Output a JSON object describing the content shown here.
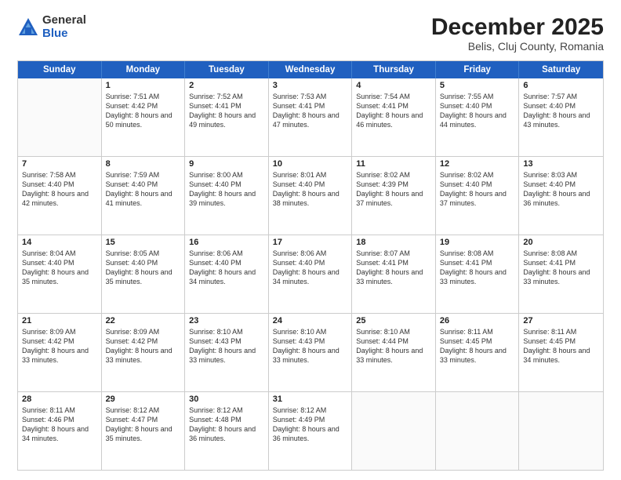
{
  "logo": {
    "general": "General",
    "blue": "Blue"
  },
  "title": "December 2025",
  "location": "Belis, Cluj County, Romania",
  "days": [
    "Sunday",
    "Monday",
    "Tuesday",
    "Wednesday",
    "Thursday",
    "Friday",
    "Saturday"
  ],
  "weeks": [
    [
      {
        "day": "",
        "empty": true
      },
      {
        "day": "1",
        "sunrise": "7:51 AM",
        "sunset": "4:42 PM",
        "daylight": "8 hours and 50 minutes."
      },
      {
        "day": "2",
        "sunrise": "7:52 AM",
        "sunset": "4:41 PM",
        "daylight": "8 hours and 49 minutes."
      },
      {
        "day": "3",
        "sunrise": "7:53 AM",
        "sunset": "4:41 PM",
        "daylight": "8 hours and 47 minutes."
      },
      {
        "day": "4",
        "sunrise": "7:54 AM",
        "sunset": "4:41 PM",
        "daylight": "8 hours and 46 minutes."
      },
      {
        "day": "5",
        "sunrise": "7:55 AM",
        "sunset": "4:40 PM",
        "daylight": "8 hours and 44 minutes."
      },
      {
        "day": "6",
        "sunrise": "7:57 AM",
        "sunset": "4:40 PM",
        "daylight": "8 hours and 43 minutes."
      }
    ],
    [
      {
        "day": "7",
        "sunrise": "7:58 AM",
        "sunset": "4:40 PM",
        "daylight": "8 hours and 42 minutes."
      },
      {
        "day": "8",
        "sunrise": "7:59 AM",
        "sunset": "4:40 PM",
        "daylight": "8 hours and 41 minutes."
      },
      {
        "day": "9",
        "sunrise": "8:00 AM",
        "sunset": "4:40 PM",
        "daylight": "8 hours and 39 minutes."
      },
      {
        "day": "10",
        "sunrise": "8:01 AM",
        "sunset": "4:40 PM",
        "daylight": "8 hours and 38 minutes."
      },
      {
        "day": "11",
        "sunrise": "8:02 AM",
        "sunset": "4:39 PM",
        "daylight": "8 hours and 37 minutes."
      },
      {
        "day": "12",
        "sunrise": "8:02 AM",
        "sunset": "4:40 PM",
        "daylight": "8 hours and 37 minutes."
      },
      {
        "day": "13",
        "sunrise": "8:03 AM",
        "sunset": "4:40 PM",
        "daylight": "8 hours and 36 minutes."
      }
    ],
    [
      {
        "day": "14",
        "sunrise": "8:04 AM",
        "sunset": "4:40 PM",
        "daylight": "8 hours and 35 minutes."
      },
      {
        "day": "15",
        "sunrise": "8:05 AM",
        "sunset": "4:40 PM",
        "daylight": "8 hours and 35 minutes."
      },
      {
        "day": "16",
        "sunrise": "8:06 AM",
        "sunset": "4:40 PM",
        "daylight": "8 hours and 34 minutes."
      },
      {
        "day": "17",
        "sunrise": "8:06 AM",
        "sunset": "4:40 PM",
        "daylight": "8 hours and 34 minutes."
      },
      {
        "day": "18",
        "sunrise": "8:07 AM",
        "sunset": "4:41 PM",
        "daylight": "8 hours and 33 minutes."
      },
      {
        "day": "19",
        "sunrise": "8:08 AM",
        "sunset": "4:41 PM",
        "daylight": "8 hours and 33 minutes."
      },
      {
        "day": "20",
        "sunrise": "8:08 AM",
        "sunset": "4:41 PM",
        "daylight": "8 hours and 33 minutes."
      }
    ],
    [
      {
        "day": "21",
        "sunrise": "8:09 AM",
        "sunset": "4:42 PM",
        "daylight": "8 hours and 33 minutes."
      },
      {
        "day": "22",
        "sunrise": "8:09 AM",
        "sunset": "4:42 PM",
        "daylight": "8 hours and 33 minutes."
      },
      {
        "day": "23",
        "sunrise": "8:10 AM",
        "sunset": "4:43 PM",
        "daylight": "8 hours and 33 minutes."
      },
      {
        "day": "24",
        "sunrise": "8:10 AM",
        "sunset": "4:43 PM",
        "daylight": "8 hours and 33 minutes."
      },
      {
        "day": "25",
        "sunrise": "8:10 AM",
        "sunset": "4:44 PM",
        "daylight": "8 hours and 33 minutes."
      },
      {
        "day": "26",
        "sunrise": "8:11 AM",
        "sunset": "4:45 PM",
        "daylight": "8 hours and 33 minutes."
      },
      {
        "day": "27",
        "sunrise": "8:11 AM",
        "sunset": "4:45 PM",
        "daylight": "8 hours and 34 minutes."
      }
    ],
    [
      {
        "day": "28",
        "sunrise": "8:11 AM",
        "sunset": "4:46 PM",
        "daylight": "8 hours and 34 minutes."
      },
      {
        "day": "29",
        "sunrise": "8:12 AM",
        "sunset": "4:47 PM",
        "daylight": "8 hours and 35 minutes."
      },
      {
        "day": "30",
        "sunrise": "8:12 AM",
        "sunset": "4:48 PM",
        "daylight": "8 hours and 36 minutes."
      },
      {
        "day": "31",
        "sunrise": "8:12 AM",
        "sunset": "4:49 PM",
        "daylight": "8 hours and 36 minutes."
      },
      {
        "day": "",
        "empty": true
      },
      {
        "day": "",
        "empty": true
      },
      {
        "day": "",
        "empty": true
      }
    ]
  ]
}
